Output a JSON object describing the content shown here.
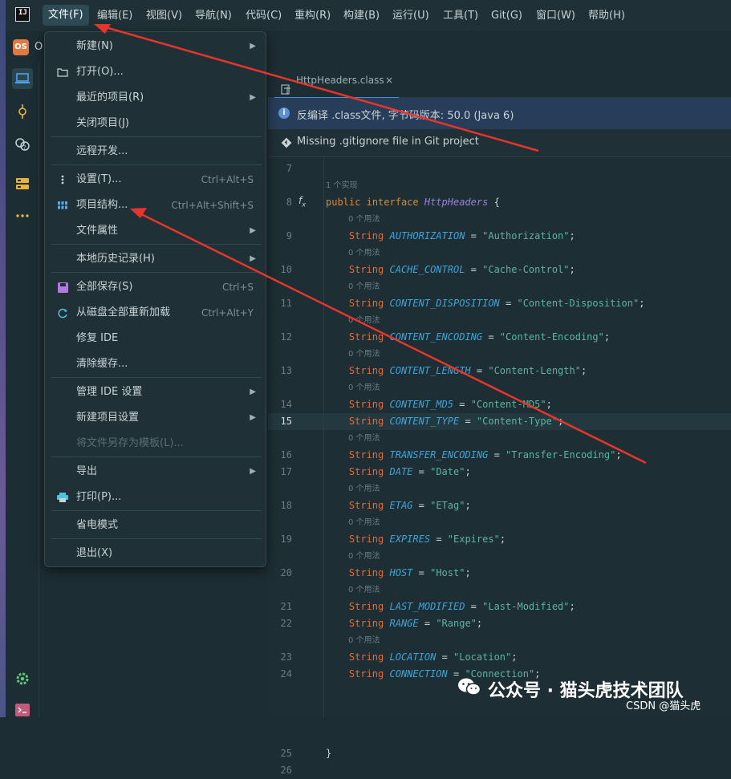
{
  "menubar": {
    "logo": "IJ",
    "items": [
      {
        "label": "文件(F)",
        "active": true
      },
      {
        "label": "编辑(E)"
      },
      {
        "label": "视图(V)"
      },
      {
        "label": "导航(N)"
      },
      {
        "label": "代码(C)"
      },
      {
        "label": "重构(R)"
      },
      {
        "label": "构建(B)"
      },
      {
        "label": "运行(U)"
      },
      {
        "label": "工具(T)"
      },
      {
        "label": "Git(G)"
      },
      {
        "label": "窗口(W)"
      },
      {
        "label": "帮助(H)"
      }
    ]
  },
  "project": {
    "badge": "OS",
    "name_fragment": "O"
  },
  "sidebar": {
    "icons": [
      "project-icon",
      "commit-icon",
      "services-icon",
      "database-icon",
      "more-icon",
      "settings-icon",
      "terminal-icon"
    ]
  },
  "editor": {
    "tab_label": "HttpHeaders.class",
    "tab_close": "×",
    "banner_info": "反编译 .class文件, 字节码版本: 50.0 (Java 6)",
    "banner_git": "Missing .gitignore file in Git project",
    "hint_impl": "1 个实现",
    "hint_usage": "0 个用法",
    "decl": {
      "kw1": "public",
      "kw2": "interface",
      "name": "HttpHeaders",
      "brace": "{"
    },
    "fields": [
      {
        "num": "9",
        "name": "AUTHORIZATION",
        "value": "\"Authorization\""
      },
      {
        "num": "10",
        "name": "CACHE_CONTROL",
        "value": "\"Cache-Control\""
      },
      {
        "num": "11",
        "name": "CONTENT_DISPOSITION",
        "value": "\"Content-Disposition\""
      },
      {
        "num": "12",
        "name": "CONTENT_ENCODING",
        "value": "\"Content-Encoding\""
      },
      {
        "num": "13",
        "name": "CONTENT_LENGTH",
        "value": "\"Content-Length\""
      },
      {
        "num": "14",
        "name": "CONTENT_MD5",
        "value": "\"Content-MD5\""
      },
      {
        "num": "15",
        "name": "CONTENT_TYPE",
        "value": "\"Content-Type\""
      },
      {
        "num": "16",
        "name": "TRANSFER_ENCODING",
        "value": "\"Transfer-Encoding\""
      },
      {
        "num": "17",
        "name": "DATE",
        "value": "\"Date\""
      },
      {
        "num": "18",
        "name": "ETAG",
        "value": "\"ETag\""
      },
      {
        "num": "19",
        "name": "EXPIRES",
        "value": "\"Expires\""
      },
      {
        "num": "20",
        "name": "HOST",
        "value": "\"Host\""
      },
      {
        "num": "21",
        "name": "LAST_MODIFIED",
        "value": "\"Last-Modified\""
      },
      {
        "num": "22",
        "name": "RANGE",
        "value": "\"Range\""
      },
      {
        "num": "23",
        "name": "LOCATION",
        "value": "\"Location\""
      },
      {
        "num": "24",
        "name": "CONNECTION",
        "value": "\"Connection\""
      }
    ],
    "line_nums": {
      "l7": "7",
      "l8": "8",
      "l25": "25",
      "l26": "26"
    },
    "close_brace": "}",
    "type_kw": "String",
    "eq": "=",
    "semi": ";"
  },
  "file_menu": {
    "items": [
      {
        "label": "新建(N)",
        "submenu": true
      },
      {
        "label": "打开(O)...",
        "icon": "folder-icon"
      },
      {
        "label": "最近的项目(R)",
        "submenu": true
      },
      {
        "label": "关闭项目(J)"
      },
      {
        "label": "远程开发..."
      },
      {
        "label": "设置(T)...",
        "shortcut": "Ctrl+Alt+S",
        "icon": "kebab-icon"
      },
      {
        "label": "项目结构...",
        "shortcut": "Ctrl+Alt+Shift+S",
        "icon": "grid-icon"
      },
      {
        "label": "文件属性",
        "submenu": true
      },
      {
        "label": "本地历史记录(H)",
        "submenu": true
      },
      {
        "label": "全部保存(S)",
        "shortcut": "Ctrl+S",
        "icon": "save-icon"
      },
      {
        "label": "从磁盘全部重新加载",
        "shortcut": "Ctrl+Alt+Y",
        "icon": "reload-icon"
      },
      {
        "label": "修复 IDE"
      },
      {
        "label": "清除缓存..."
      },
      {
        "label": "管理 IDE 设置",
        "submenu": true
      },
      {
        "label": "新建项目设置",
        "submenu": true
      },
      {
        "label": "将文件另存为模板(L)...",
        "disabled": true
      },
      {
        "label": "导出",
        "submenu": true
      },
      {
        "label": "打印(P)...",
        "icon": "print-icon"
      },
      {
        "label": "省电模式"
      },
      {
        "label": "退出(X)"
      }
    ]
  },
  "watermark": {
    "text": "公众号 · 猫头虎技术团队",
    "csdn": "CSDN @猫头虎"
  },
  "colors": {
    "annotation_arrow": "#e8352b",
    "accent": "#3d8fd8"
  }
}
